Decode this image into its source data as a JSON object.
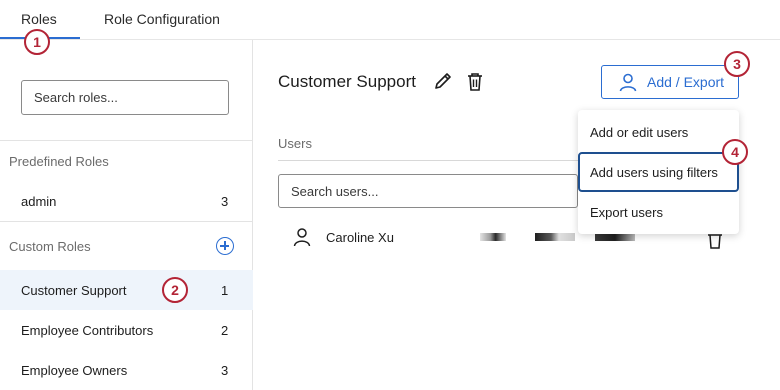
{
  "tabs": [
    {
      "label": "Roles"
    },
    {
      "label": "Role Configuration"
    }
  ],
  "sidebar": {
    "search_placeholder": "Search roles...",
    "predefined_header": "Predefined Roles",
    "predefined_roles": [
      {
        "name": "admin",
        "count": "3"
      }
    ],
    "custom_header": "Custom Roles",
    "custom_roles": [
      {
        "name": "Customer Support",
        "count": "1"
      },
      {
        "name": "Employee Contributors",
        "count": "2"
      },
      {
        "name": "Employee Owners",
        "count": "3"
      }
    ]
  },
  "main": {
    "role_title": "Customer Support",
    "add_export_label": "Add / Export",
    "users_label": "Users",
    "user_search_placeholder": "Search users...",
    "users": [
      {
        "name": "Caroline Xu"
      }
    ]
  },
  "menu": {
    "items": [
      {
        "label": "Add or edit users"
      },
      {
        "label": "Add users using filters"
      },
      {
        "label": "Export users"
      }
    ]
  },
  "callouts": [
    "1",
    "2",
    "3",
    "4"
  ],
  "colors": {
    "accent": "#2b6dd1",
    "callout": "#b32436",
    "selected_row": "#eef4fb"
  }
}
